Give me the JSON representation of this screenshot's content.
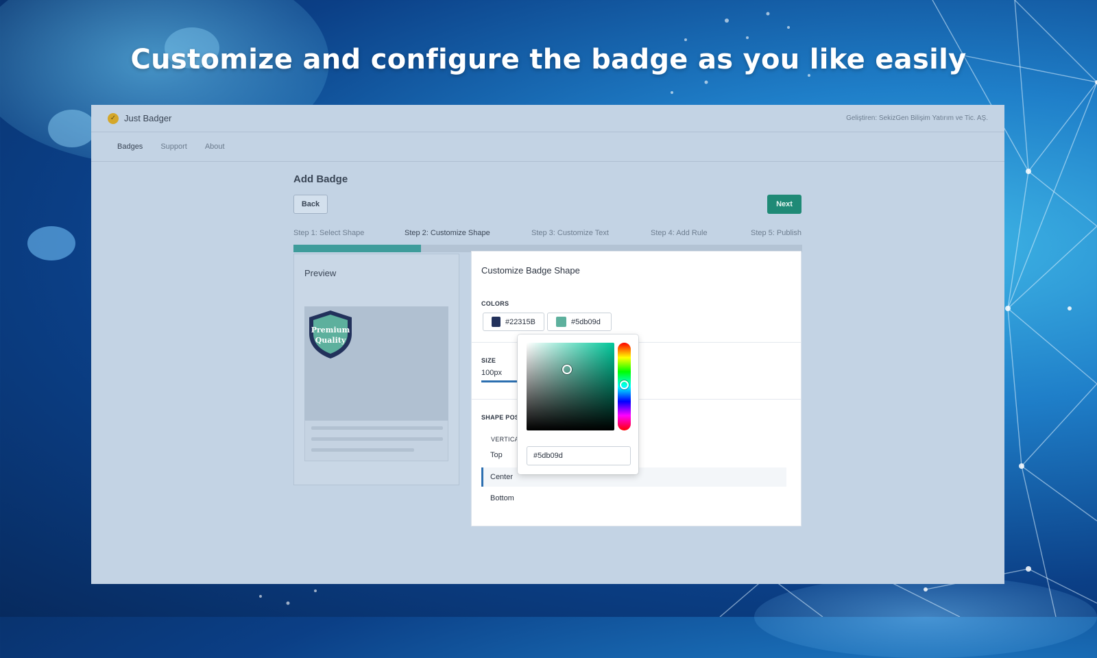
{
  "headline": "Customize and configure the badge as you like easily",
  "app": {
    "title": "Just Badger",
    "developer": "Geliştiren: SekizGen Bilişim Yatırım ve Tic. AŞ."
  },
  "nav": [
    "Badges",
    "Support",
    "About"
  ],
  "page": {
    "title": "Add Badge",
    "back_label": "Back",
    "next_label": "Next"
  },
  "steps": [
    "Step 1: Select Shape",
    "Step 2: Customize Shape",
    "Step 3: Customize Text",
    "Step 4: Add Rule",
    "Step 5: Publish"
  ],
  "progress_fraction": 0.25,
  "preview": {
    "title": "Preview",
    "badge_text_line1": "Premium",
    "badge_text_line2": "Quality"
  },
  "customize": {
    "title": "Customize Badge Shape",
    "colors_label": "COLORS",
    "color1": "#22315B",
    "color2": "#5db09d",
    "size_label": "SIZE",
    "size_value": "100px",
    "shape_position_label": "SHAPE POSIT",
    "vertical_label": "VERTICAL",
    "options": [
      "Top",
      "Center",
      "Bottom"
    ],
    "selected_option": "Center"
  },
  "picker": {
    "hex_value": "#5db09d"
  },
  "colors": {
    "accent": "#1f8a76",
    "progress": "#3e9c9b",
    "badge_dark": "#22315B",
    "badge_teal": "#5db09d"
  }
}
